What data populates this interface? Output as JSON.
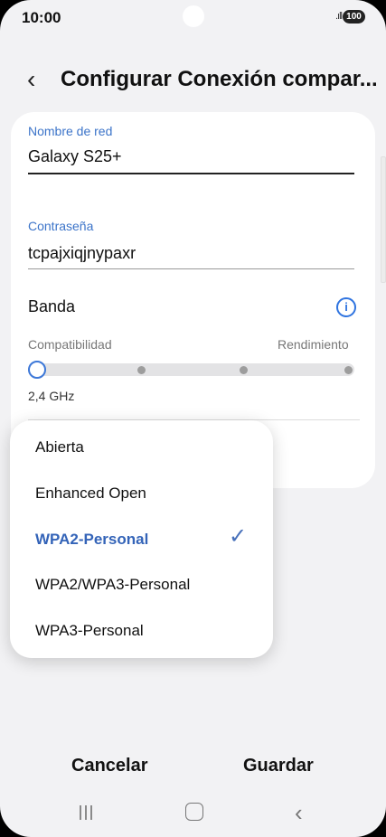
{
  "status": {
    "time": "10:00",
    "signal": ".ıll",
    "battery": "100"
  },
  "header": {
    "back_icon": "chevron-left-icon",
    "title": "Configurar Conexión compar..."
  },
  "form": {
    "network_name": {
      "label": "Nombre de red",
      "value": "Galaxy S25+"
    },
    "password": {
      "label": "Contraseña",
      "value": "tcpajxiqjnypaxr"
    },
    "band": {
      "label": "Banda",
      "left_label": "Compatibilidad",
      "right_label": "Rendimiento",
      "selected_value": "2,4 GHz",
      "slider_position": 0
    }
  },
  "security_dropdown": {
    "options": [
      "Abierta",
      "Enhanced Open",
      "WPA2-Personal",
      "WPA2/WPA3-Personal",
      "WPA3-Personal"
    ],
    "selected": "WPA2-Personal"
  },
  "footer": {
    "cancel": "Cancelar",
    "save": "Guardar"
  },
  "navigation": {
    "recent_icon": "recent-apps-icon",
    "home_icon": "home-icon",
    "back_icon": "back-icon"
  },
  "colors": {
    "accent": "#3464b8",
    "background": "#f2f2f4"
  }
}
